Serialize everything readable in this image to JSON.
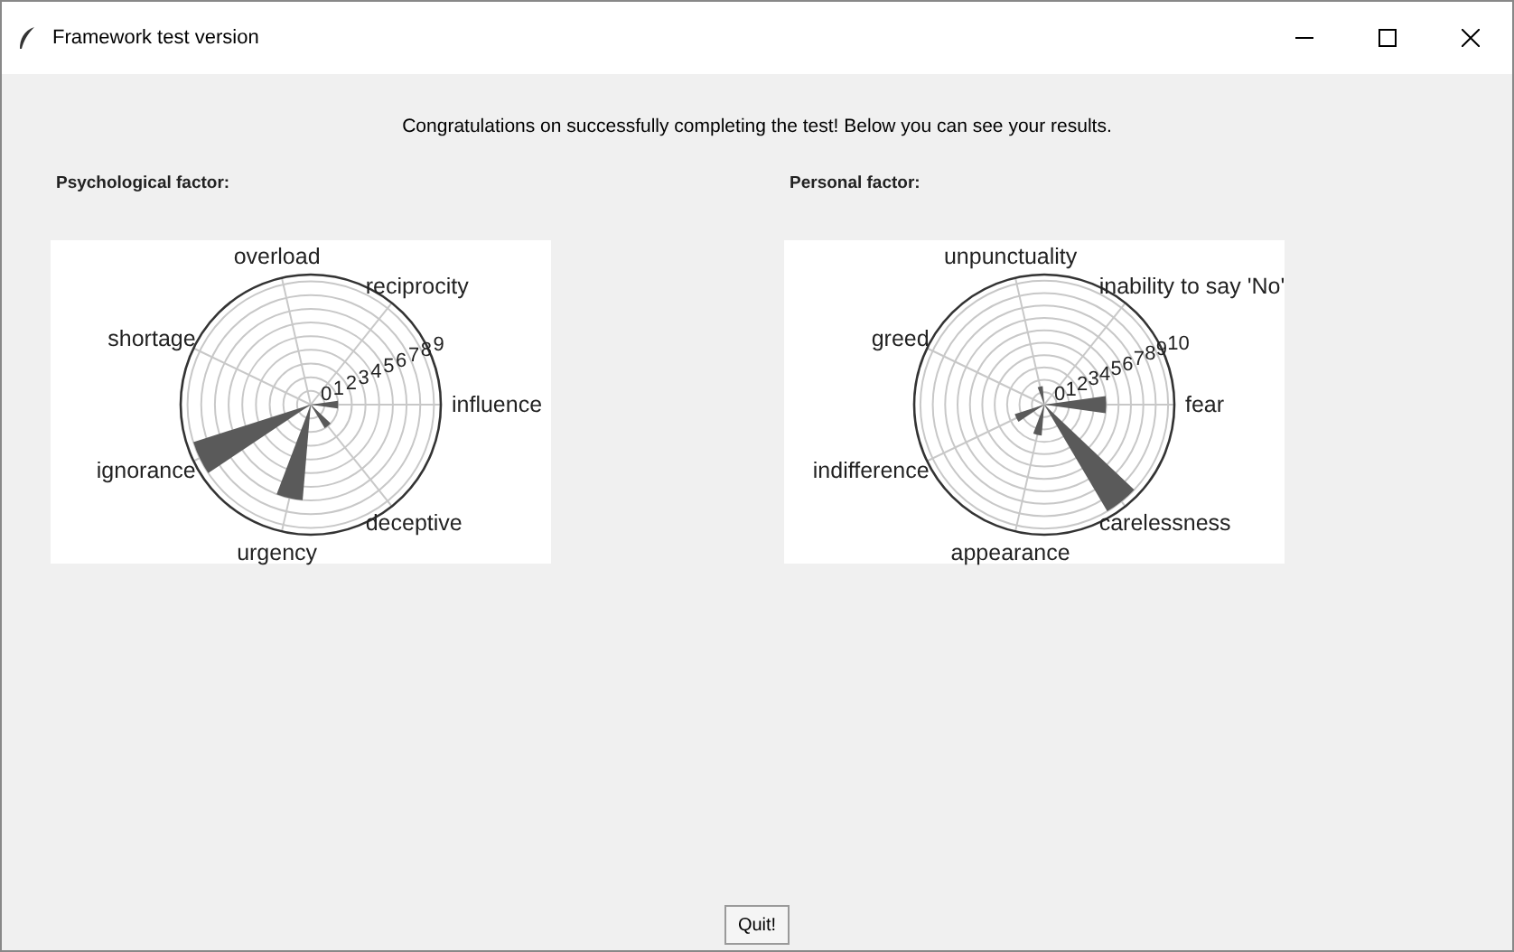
{
  "window": {
    "title": "Framework test version"
  },
  "message": "Congratulations on successfully completing the test! Below you can see your results.",
  "panels": [
    {
      "label": "Psychological factor:",
      "axis_labels": [
        "overload",
        "reciprocity",
        "shortage",
        "influence",
        "ignorance",
        "deceptive",
        "urgency"
      ],
      "radial_ticks": [
        "0",
        "1",
        "2",
        "3",
        "4",
        "5",
        "6",
        "7",
        "8",
        "9"
      ]
    },
    {
      "label": "Personal factor:",
      "axis_labels": [
        "unpunctuality",
        "inability to say 'No'",
        "greed",
        "fear",
        "indifference",
        "carelessness",
        "appearance"
      ],
      "radial_ticks": [
        "0",
        "1",
        "2",
        "3",
        "4",
        "5",
        "6",
        "7",
        "8",
        "9",
        "10"
      ]
    }
  ],
  "quit_button": "Quit!"
}
